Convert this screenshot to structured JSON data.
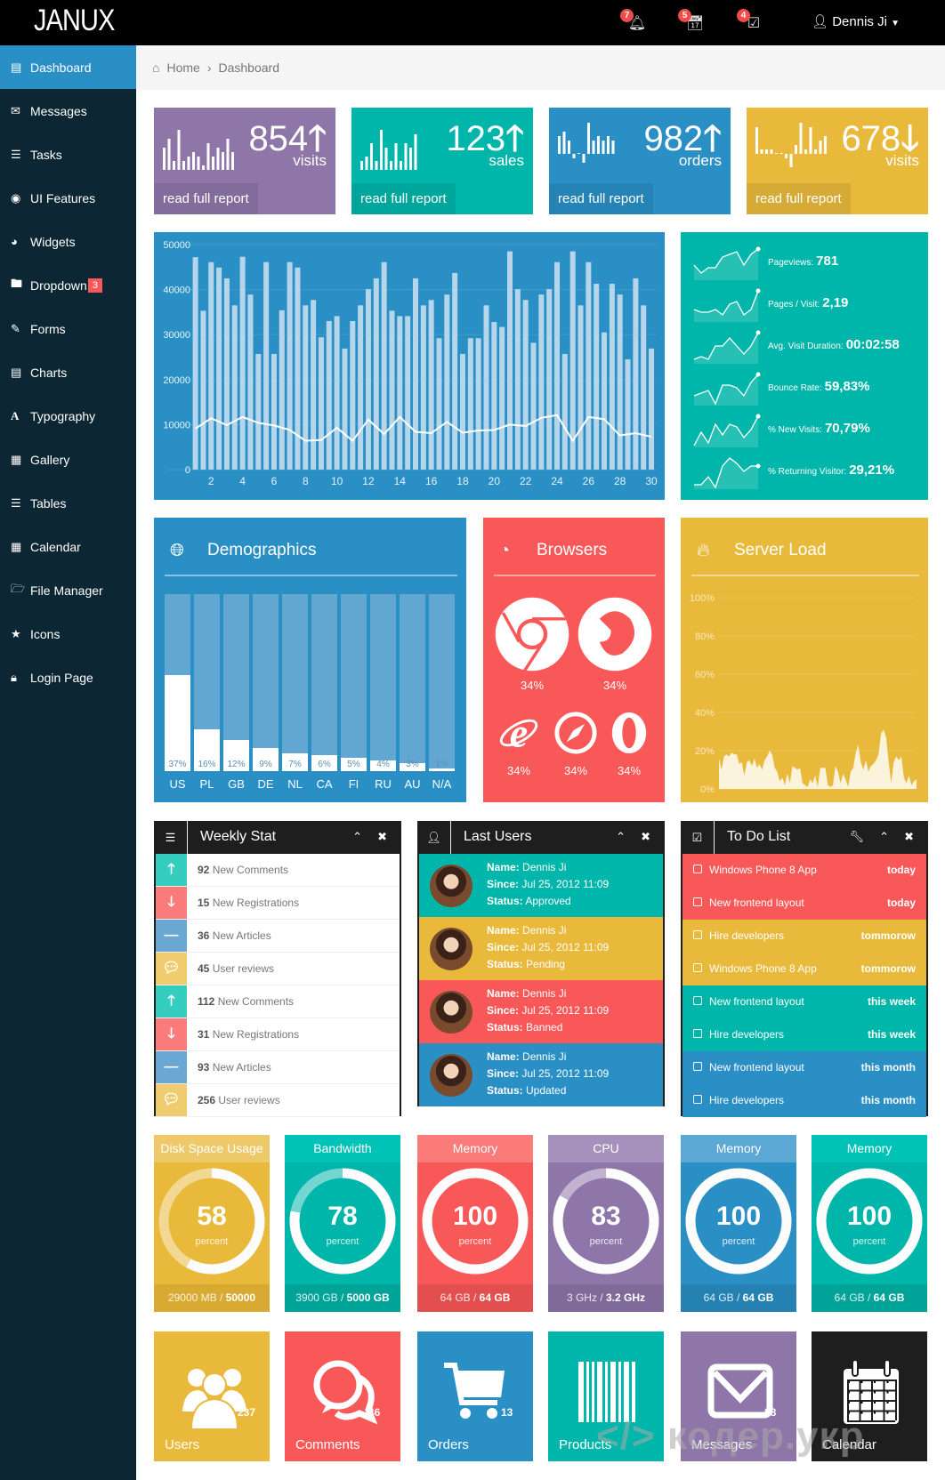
{
  "app": {
    "logo": "JANUX",
    "user": "Dennis Ji",
    "notifications": [
      {
        "icon": "bell-icon",
        "count": "7"
      },
      {
        "icon": "calendar-icon",
        "count": "5"
      },
      {
        "icon": "checkbox-icon",
        "count": "4"
      }
    ]
  },
  "sidebar": {
    "items": [
      {
        "label": "Dashboard",
        "icon": "bar-chart-icon",
        "active": true
      },
      {
        "label": "Messages",
        "icon": "envelope-icon"
      },
      {
        "label": "Tasks",
        "icon": "tasks-icon"
      },
      {
        "label": "UI Features",
        "icon": "eye-icon"
      },
      {
        "label": "Widgets",
        "icon": "dashboard-icon"
      },
      {
        "label": "Dropdown",
        "icon": "folder-icon",
        "badge": "3"
      },
      {
        "label": "Forms",
        "icon": "edit-icon"
      },
      {
        "label": "Charts",
        "icon": "list-alt-icon"
      },
      {
        "label": "Typography",
        "icon": "font-icon"
      },
      {
        "label": "Gallery",
        "icon": "picture-icon"
      },
      {
        "label": "Tables",
        "icon": "align-justify-icon"
      },
      {
        "label": "Calendar",
        "icon": "calendar-icon"
      },
      {
        "label": "File Manager",
        "icon": "folder-open-icon"
      },
      {
        "label": "Icons",
        "icon": "star-icon"
      },
      {
        "label": "Login Page",
        "icon": "lock-icon"
      }
    ]
  },
  "breadcrumb": {
    "home": "Home",
    "current": "Dashboard"
  },
  "stat_boxes": [
    {
      "value": "854",
      "unit": "visits",
      "trend": "up",
      "link": "read full report",
      "color": "#8e76a9",
      "bars": [
        5,
        7,
        2,
        9,
        2,
        3,
        4,
        3,
        1,
        6,
        3,
        5,
        4,
        7,
        4
      ]
    },
    {
      "value": "123",
      "unit": "sales",
      "trend": "up",
      "link": "read full report",
      "color": "#00b5a9",
      "bars": [
        2,
        3,
        6,
        2,
        9,
        5,
        2,
        6,
        2,
        6,
        5,
        8
      ]
    },
    {
      "value": "982",
      "unit": "orders",
      "trend": "up",
      "link": "read full report",
      "color": "#2a8fc5",
      "bars": [
        4,
        5,
        3,
        -1,
        0,
        -2,
        7,
        3,
        4,
        3,
        4,
        3
      ]
    },
    {
      "value": "678",
      "unit": "visits",
      "trend": "down",
      "link": "read full report",
      "color": "#e8b93b",
      "bars": [
        6,
        1,
        1,
        1,
        0,
        0,
        -1,
        -3,
        2,
        7,
        1,
        6,
        1,
        3,
        4
      ]
    }
  ],
  "chart_data": [
    {
      "type": "bar",
      "ylim": [
        0,
        50000
      ],
      "yticks": [
        "0",
        "10000",
        "20000",
        "30000",
        "40000",
        "50000"
      ],
      "xticks": [
        "2",
        "4",
        "6",
        "8",
        "10",
        "12",
        "14",
        "16",
        "18",
        "20",
        "22",
        "24",
        "26",
        "28",
        "30"
      ],
      "x_start": 1,
      "x_step": 0.5,
      "bars": [
        47200,
        35300,
        46100,
        44900,
        42500,
        36500,
        47300,
        38900,
        25700,
        46100,
        25700,
        35400,
        46100,
        44900,
        36500,
        37700,
        29400,
        33000,
        34100,
        26900,
        33000,
        36500,
        40100,
        42500,
        46100,
        35300,
        34100,
        34100,
        42500,
        36500,
        37700,
        29200,
        38900,
        43700,
        25700,
        29200,
        29200,
        36500,
        32800,
        31700,
        48500,
        40100,
        37700,
        28200,
        38900,
        40100,
        46100,
        25700,
        48500,
        36500,
        46100,
        41300,
        30500,
        41300,
        38900,
        24500,
        42500,
        36500,
        26900
      ],
      "line": [
        9100,
        11400,
        9900,
        11700,
        10400,
        9800,
        8800,
        6400,
        6600,
        9300,
        6400,
        11100,
        7900,
        11700,
        8400,
        8100,
        10600,
        8200,
        8700,
        8800,
        10000,
        9700,
        11500,
        12100,
        6400,
        11700,
        11200,
        7600,
        8100,
        7300
      ]
    },
    {
      "type": "bar",
      "title": "Demographics",
      "categories": [
        "US",
        "PL",
        "GB",
        "DE",
        "NL",
        "CA",
        "FI",
        "RU",
        "AU",
        "N/A"
      ],
      "values": [
        37,
        16,
        12,
        9,
        7,
        6,
        5,
        4,
        3,
        1
      ],
      "labels": [
        "37%",
        "16%",
        "12%",
        "9%",
        "7%",
        "6%",
        "5%",
        "4%",
        "3%",
        "1%"
      ]
    },
    {
      "type": "area",
      "title": "Server Load",
      "yticks": [
        "0%",
        "20%",
        "40%",
        "60%",
        "80%",
        "100%"
      ],
      "ylim": [
        0,
        100
      ],
      "values": [
        16,
        10,
        17,
        18,
        17,
        19,
        18,
        18,
        13,
        14,
        7,
        14,
        15,
        12,
        16,
        11,
        13,
        10,
        15,
        17,
        20,
        18,
        11,
        9,
        4,
        6,
        2,
        8,
        3,
        12,
        11,
        10,
        11,
        3,
        2,
        1,
        5,
        3,
        7,
        1,
        11,
        11,
        11,
        2,
        1,
        2,
        12,
        9,
        3,
        8,
        5,
        1,
        9,
        11,
        19,
        23,
        14,
        10,
        15,
        9,
        12,
        13,
        15,
        18,
        29,
        31,
        27,
        14,
        3,
        14,
        17,
        15,
        17,
        6,
        3,
        7,
        2,
        4,
        5
      ]
    }
  ],
  "site_stats": [
    {
      "label": "Pageviews:",
      "value": "781",
      "spark": [
        5,
        2,
        4,
        4,
        8,
        9,
        10,
        5,
        9,
        11
      ]
    },
    {
      "label": "Pages / Visit:",
      "value": "2,19",
      "spark": [
        4,
        3,
        3,
        4,
        2,
        6,
        7,
        2,
        4,
        11
      ]
    },
    {
      "label": "Avg. Visit Duration:",
      "value": "00:02:58",
      "spark": [
        1,
        2,
        1,
        6,
        6,
        9,
        6,
        3,
        6,
        11
      ]
    },
    {
      "label": "Bounce Rate:",
      "value": "59,83%",
      "spark": [
        3,
        4,
        5,
        0,
        7,
        7,
        6,
        3,
        8,
        11
      ]
    },
    {
      "label": "% New Visits:",
      "value": "70,79%",
      "spark": [
        0,
        5,
        1,
        8,
        4,
        8,
        7,
        3,
        6,
        11
      ]
    },
    {
      "label": "% Returning Visitor:",
      "value": "29,21%",
      "spark": [
        1,
        1,
        4,
        0,
        8,
        11,
        9,
        6,
        8,
        8
      ]
    }
  ],
  "browsers": {
    "title": "Browsers",
    "items": [
      {
        "name": "chrome-icon",
        "value": "34%"
      },
      {
        "name": "firefox-icon",
        "value": "34%"
      },
      {
        "name": "internet-explorer-icon",
        "value": "34%"
      },
      {
        "name": "safari-icon",
        "value": "34%"
      },
      {
        "name": "opera-icon",
        "value": "34%"
      }
    ]
  },
  "weekly_stat": {
    "title": "Weekly Stat",
    "rows": [
      {
        "count": "92",
        "text": "New Comments",
        "kind": "up",
        "color": "#35cdbf"
      },
      {
        "count": "15",
        "text": "New Registrations",
        "kind": "down",
        "color": "#fb7b7b"
      },
      {
        "count": "36",
        "text": "New Articles",
        "kind": "minus",
        "color": "#6aa8d3"
      },
      {
        "count": "45",
        "text": "User reviews",
        "kind": "comment",
        "color": "#f0cc6e"
      },
      {
        "count": "112",
        "text": "New Comments",
        "kind": "up",
        "color": "#35cdbf"
      },
      {
        "count": "31",
        "text": "New Registrations",
        "kind": "down",
        "color": "#fb7b7b"
      },
      {
        "count": "93",
        "text": "New Articles",
        "kind": "minus",
        "color": "#6aa8d3"
      },
      {
        "count": "256",
        "text": "User reviews",
        "kind": "comment",
        "color": "#f0cc6e"
      }
    ]
  },
  "last_users": {
    "title": "Last Users",
    "name_label": "Name:",
    "since_label": "Since:",
    "status_label": "Status:",
    "rows": [
      {
        "name": "Dennis Ji",
        "since": "Jul 25, 2012 11:09",
        "status": "Approved",
        "color": "#00b5a9"
      },
      {
        "name": "Dennis Ji",
        "since": "Jul 25, 2012 11:09",
        "status": "Pending",
        "color": "#e8b93b"
      },
      {
        "name": "Dennis Ji",
        "since": "Jul 25, 2012 11:09",
        "status": "Banned",
        "color": "#f95858"
      },
      {
        "name": "Dennis Ji",
        "since": "Jul 25, 2012 11:09",
        "status": "Updated",
        "color": "#2a8fc5"
      }
    ]
  },
  "todo": {
    "title": "To Do List",
    "rows": [
      {
        "text": "Windows Phone 8 App",
        "due": "today",
        "color": "#f95858"
      },
      {
        "text": "New frontend layout",
        "due": "today",
        "color": "#f95858"
      },
      {
        "text": "Hire developers",
        "due": "tommorow",
        "color": "#e8b93b"
      },
      {
        "text": "Windows Phone 8 App",
        "due": "tommorow",
        "color": "#e8b93b"
      },
      {
        "text": "New frontend layout",
        "due": "this week",
        "color": "#00b5a9"
      },
      {
        "text": "Hire developers",
        "due": "this week",
        "color": "#00b5a9"
      },
      {
        "text": "New frontend layout",
        "due": "this month",
        "color": "#2a8fc5"
      },
      {
        "text": "Hire developers",
        "due": "this month",
        "color": "#2a8fc5"
      }
    ]
  },
  "gauges": [
    {
      "title": "Disk Space Usage",
      "value": "58",
      "percent": 58,
      "unit": "percent",
      "used": "29000 MB /",
      "total": "50000",
      "color": "#e8b93b",
      "head": "#eec96a",
      "foot": "#d9aa32"
    },
    {
      "title": "Bandwidth",
      "value": "78",
      "percent": 78,
      "unit": "percent",
      "used": "3900 GB /",
      "total": "5000 GB",
      "color": "#00b5a9",
      "head": "#00c2b6",
      "foot": "#00a398"
    },
    {
      "title": "Memory",
      "value": "100",
      "percent": 100,
      "unit": "percent",
      "used": "64 GB /",
      "total": "64 GB",
      "color": "#f95858",
      "head": "#fb7b7b",
      "foot": "#e34f4f"
    },
    {
      "title": "CPU",
      "value": "83",
      "percent": 83,
      "unit": "percent",
      "used": "3 GHz /",
      "total": "3.2 GHz",
      "color": "#8e76a9",
      "head": "#a691bd",
      "foot": "#806a99"
    },
    {
      "title": "Memory",
      "value": "100",
      "percent": 100,
      "unit": "percent",
      "used": "64 GB /",
      "total": "64 GB",
      "color": "#2a8fc5",
      "head": "#5ba8d4",
      "foot": "#2581b2"
    },
    {
      "title": "Memory",
      "value": "100",
      "percent": 100,
      "unit": "percent",
      "used": "64 GB /",
      "total": "64 GB",
      "color": "#00b5a9",
      "head": "#00c2b6",
      "foot": "#00a398"
    }
  ],
  "tiles": [
    {
      "label": "Users",
      "count": "237",
      "icon": "users-icon",
      "color": "#e8b93b"
    },
    {
      "label": "Comments",
      "count": "46",
      "icon": "comments-icon",
      "color": "#f95858"
    },
    {
      "label": "Orders",
      "count": "13",
      "icon": "shopping-cart-icon",
      "color": "#2a8fc5"
    },
    {
      "label": "Products",
      "count": "",
      "icon": "barcode-icon",
      "color": "#00b5a9"
    },
    {
      "label": "Messages",
      "count": "88",
      "icon": "envelope-icon",
      "color": "#8e76a9"
    },
    {
      "label": "Calendar",
      "count": "",
      "icon": "calendar-icon",
      "color": "#1e1e1e"
    }
  ],
  "watermark": "</> кодер.укр"
}
